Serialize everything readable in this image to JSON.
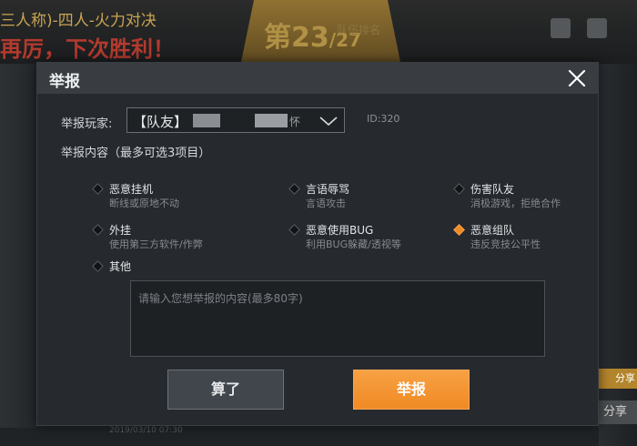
{
  "background": {
    "mode_title": "三人称)-四人-火力对决",
    "defeat_text": "再厉，下次胜利！",
    "rank": "第23",
    "rank_total": "/27",
    "rank_caption": "队伍排名",
    "share_small": "分享",
    "share_button": "分享",
    "footer_time": "2019/03/10 07:30"
  },
  "dialog": {
    "title": "举报",
    "report_player_label": "举报玩家:",
    "player": {
      "prefix": "【队友】",
      "suffix": "怀",
      "id_label": "ID:320"
    },
    "report_content_label": "举报内容（最多可选3项目）",
    "options": [
      {
        "title": "恶意挂机",
        "desc": "断线或原地不动",
        "selected": false
      },
      {
        "title": "言语辱骂",
        "desc": "言语攻击",
        "selected": false
      },
      {
        "title": "伤害队友",
        "desc": "消极游戏，拒绝合作",
        "selected": false
      },
      {
        "title": "外挂",
        "desc": "使用第三方软件/作弊",
        "selected": false
      },
      {
        "title": "恶意使用BUG",
        "desc": "利用BUG躲藏/透视等",
        "selected": false
      },
      {
        "title": "恶意组队",
        "desc": "违反竞技公平性",
        "selected": true
      },
      {
        "title": "其他",
        "desc": "",
        "selected": false
      }
    ],
    "textarea_placeholder": "请输入您想举报的内容(最多80字)",
    "cancel_label": "算了",
    "submit_label": "举报"
  },
  "colors": {
    "accent": "#f08a24",
    "dialog_bg": "#26292d",
    "header_bg": "#393d42"
  },
  "icons": {
    "close": "close-icon",
    "dropdown": "chevron-down-icon"
  }
}
